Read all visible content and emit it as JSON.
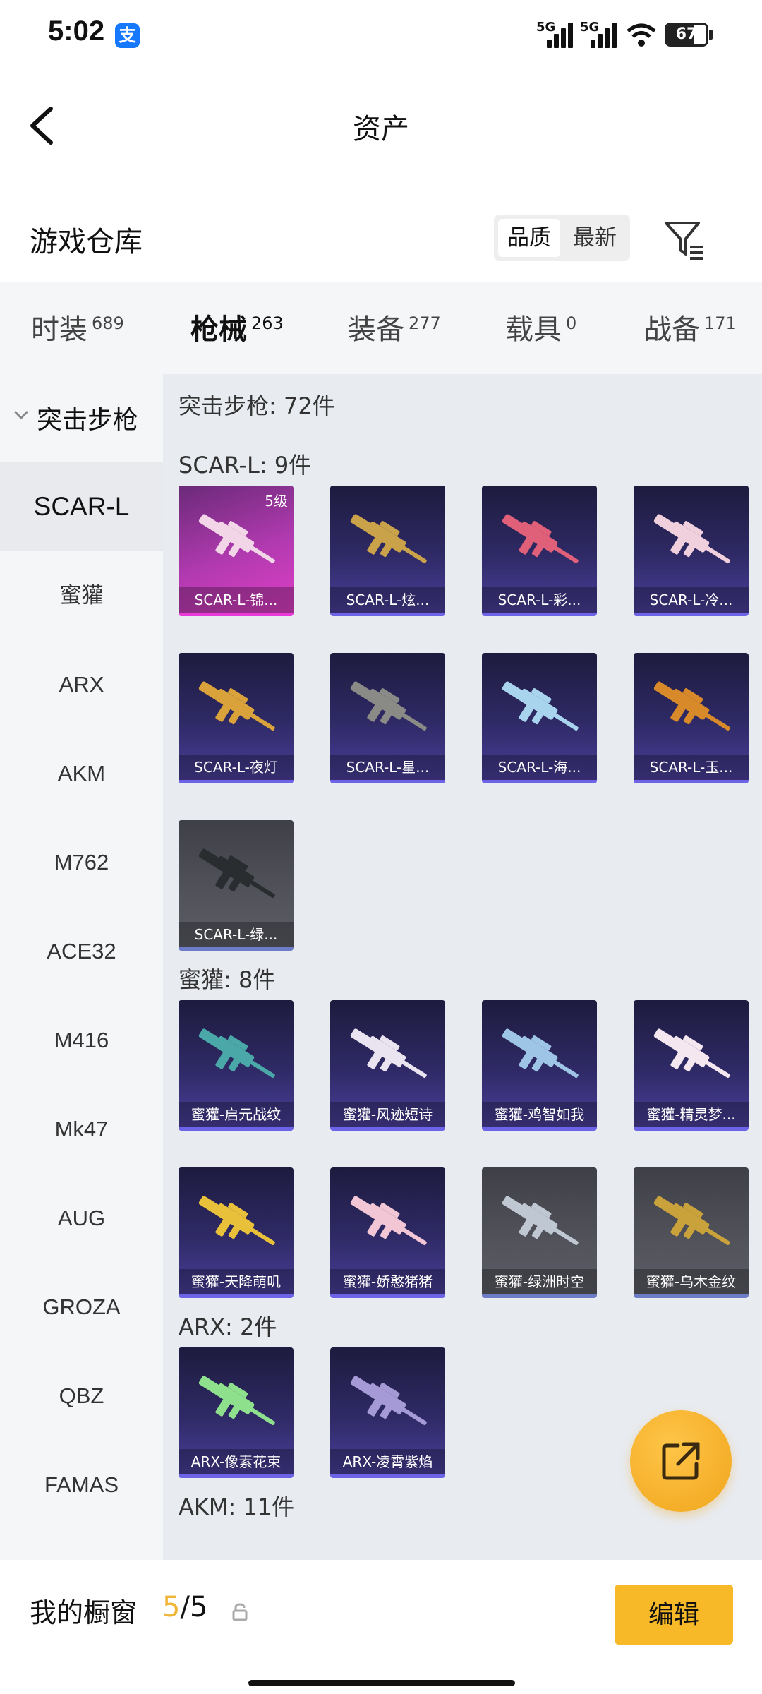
{
  "status_bar": {
    "time": "5:02",
    "app_badge": "支",
    "signal1": "5G",
    "signal2": "5G",
    "battery": "67",
    "battery_level": 0.67
  },
  "nav": {
    "title": "资产"
  },
  "warehouse": {
    "title": "游戏仓库",
    "sort_options": [
      "品质",
      "最新"
    ],
    "sort_selected": "品质"
  },
  "tabs": [
    {
      "label": "时装",
      "count": "689"
    },
    {
      "label": "枪械",
      "count": "263",
      "active": true
    },
    {
      "label": "装备",
      "count": "277"
    },
    {
      "label": "载具",
      "count": "0"
    },
    {
      "label": "战备",
      "count": "171"
    }
  ],
  "sidebar": {
    "category": "突击步枪",
    "items": [
      "SCAR-L",
      "蜜獾",
      "ARX",
      "AKM",
      "M762",
      "ACE32",
      "M416",
      "Mk47",
      "AUG",
      "GROZA",
      "QBZ",
      "FAMAS"
    ],
    "selected": "SCAR-L"
  },
  "content": {
    "category_header": "突击步枪: 72件",
    "groups": [
      {
        "header": "SCAR-L: 9件",
        "items": [
          {
            "name": "SCAR-L-锦...",
            "style": "pink",
            "badge": "5级",
            "color": "#f2d6e8"
          },
          {
            "name": "SCAR-L-炫...",
            "style": "blue",
            "color": "#c9a24a"
          },
          {
            "name": "SCAR-L-彩...",
            "style": "blue",
            "color": "#e0607a"
          },
          {
            "name": "SCAR-L-冷...",
            "style": "blue",
            "color": "#f0d0dc"
          },
          {
            "name": "SCAR-L-夜灯",
            "style": "blue",
            "color": "#d9a23a"
          },
          {
            "name": "SCAR-L-星...",
            "style": "blue",
            "color": "#8a8a86"
          },
          {
            "name": "SCAR-L-海...",
            "style": "blue",
            "color": "#a9d4ee"
          },
          {
            "name": "SCAR-L-玉...",
            "style": "blue",
            "color": "#d88a2a"
          },
          {
            "name": "SCAR-L-绿...",
            "style": "gray",
            "color": "#2a2d30"
          }
        ]
      },
      {
        "header": "蜜獾: 8件",
        "items": [
          {
            "name": "蜜獾-启元战纹",
            "style": "blue",
            "color": "#4aa9a8"
          },
          {
            "name": "蜜獾-风迹短诗",
            "style": "blue",
            "color": "#e9e4ef"
          },
          {
            "name": "蜜獾-鸡智如我",
            "style": "blue",
            "color": "#9ec4e6"
          },
          {
            "name": "蜜獾-精灵梦...",
            "style": "blue",
            "color": "#f4e7f0"
          },
          {
            "name": "蜜獾-天降萌叽",
            "style": "blue",
            "color": "#e8c03a"
          },
          {
            "name": "蜜獾-娇憨猪猪",
            "style": "blue",
            "color": "#f2c6d4"
          },
          {
            "name": "蜜獾-绿洲时空",
            "style": "gray",
            "color": "#bfc7d2"
          },
          {
            "name": "蜜獾-乌木金纹",
            "style": "gray",
            "color": "#caa23c"
          }
        ]
      },
      {
        "header": "ARX: 2件",
        "items": [
          {
            "name": "ARX-像素花束",
            "style": "blue",
            "color": "#8ee08c"
          },
          {
            "name": "ARX-凌霄紫焰",
            "style": "blue",
            "color": "#a59ad6"
          }
        ]
      },
      {
        "header": "AKM: 11件",
        "items": []
      }
    ]
  },
  "bottom_bar": {
    "title": "我的橱窗",
    "count_current": "5",
    "count_sep": "/",
    "count_total": "5",
    "edit_label": "编辑"
  },
  "colors": {
    "accent": "#f0b63a",
    "button": "#f7b928",
    "content_bg": "#e8ebf0",
    "sidebar_bg": "#f5f6f8"
  }
}
